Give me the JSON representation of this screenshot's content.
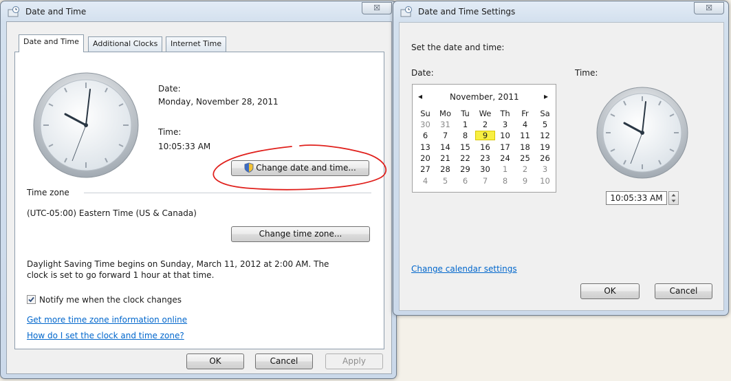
{
  "date_time_window": {
    "title": "Date and Time",
    "close_glyph": "☒",
    "tabs": [
      "Date and Time",
      "Additional Clocks",
      "Internet Time"
    ],
    "date_label": "Date:",
    "date_value": "Monday, November 28, 2011",
    "time_label": "Time:",
    "time_value": "10:05:33 AM",
    "change_date_time_button": "Change date and time...",
    "time_zone_heading": "Time zone",
    "time_zone_value": "(UTC-05:00) Eastern Time (US & Canada)",
    "change_time_zone_button": "Change time zone...",
    "dst_line1": "Daylight Saving Time begins on Sunday, March 11, 2012 at 2:00 AM. The",
    "dst_line2": "clock is set to go forward 1 hour at that time.",
    "notify_checkbox_label": "Notify me when the clock changes",
    "notify_checked": true,
    "link_more_info": "Get more time zone information online",
    "link_how_set": "How do I set the clock and time zone?",
    "ok_button": "OK",
    "cancel_button": "Cancel",
    "apply_button": "Apply",
    "annotation_color": "#e0201c"
  },
  "settings_window": {
    "title": "Date and Time Settings",
    "close_glyph": "☒",
    "instruction": "Set the date and time:",
    "date_label": "Date:",
    "time_label": "Time:",
    "calendar": {
      "month_title": "November, 2011",
      "prev_glyph": "◂",
      "next_glyph": "▸",
      "weekdays": [
        "Su",
        "Mo",
        "Tu",
        "We",
        "Th",
        "Fr",
        "Sa"
      ],
      "weeks": [
        [
          {
            "d": "30",
            "dim": true
          },
          {
            "d": "31",
            "dim": true
          },
          {
            "d": "1"
          },
          {
            "d": "2"
          },
          {
            "d": "3"
          },
          {
            "d": "4"
          },
          {
            "d": "5"
          }
        ],
        [
          {
            "d": "6"
          },
          {
            "d": "7"
          },
          {
            "d": "8"
          },
          {
            "d": "9",
            "sel": true
          },
          {
            "d": "10"
          },
          {
            "d": "11"
          },
          {
            "d": "12"
          }
        ],
        [
          {
            "d": "13"
          },
          {
            "d": "14"
          },
          {
            "d": "15"
          },
          {
            "d": "16"
          },
          {
            "d": "17"
          },
          {
            "d": "18"
          },
          {
            "d": "19"
          }
        ],
        [
          {
            "d": "20"
          },
          {
            "d": "21"
          },
          {
            "d": "22"
          },
          {
            "d": "23"
          },
          {
            "d": "24"
          },
          {
            "d": "25"
          },
          {
            "d": "26"
          }
        ],
        [
          {
            "d": "27"
          },
          {
            "d": "28"
          },
          {
            "d": "29"
          },
          {
            "d": "30"
          },
          {
            "d": "1",
            "dim": true
          },
          {
            "d": "2",
            "dim": true
          },
          {
            "d": "3",
            "dim": true
          }
        ],
        [
          {
            "d": "4",
            "dim": true
          },
          {
            "d": "5",
            "dim": true
          },
          {
            "d": "6",
            "dim": true
          },
          {
            "d": "7",
            "dim": true
          },
          {
            "d": "8",
            "dim": true
          },
          {
            "d": "9",
            "dim": true
          },
          {
            "d": "10",
            "dim": true
          }
        ]
      ],
      "selected_color": "#f8ef42"
    },
    "time_value": "10:05:33 AM",
    "change_calendar_link": "Change calendar settings",
    "ok_button": "OK",
    "cancel_button": "Cancel"
  },
  "icons": {
    "window_icon": "date-time-icon",
    "clock": "analog-clock-icon",
    "shield": "uac-shield-icon",
    "checkbox": "checkbox-checked-icon"
  }
}
